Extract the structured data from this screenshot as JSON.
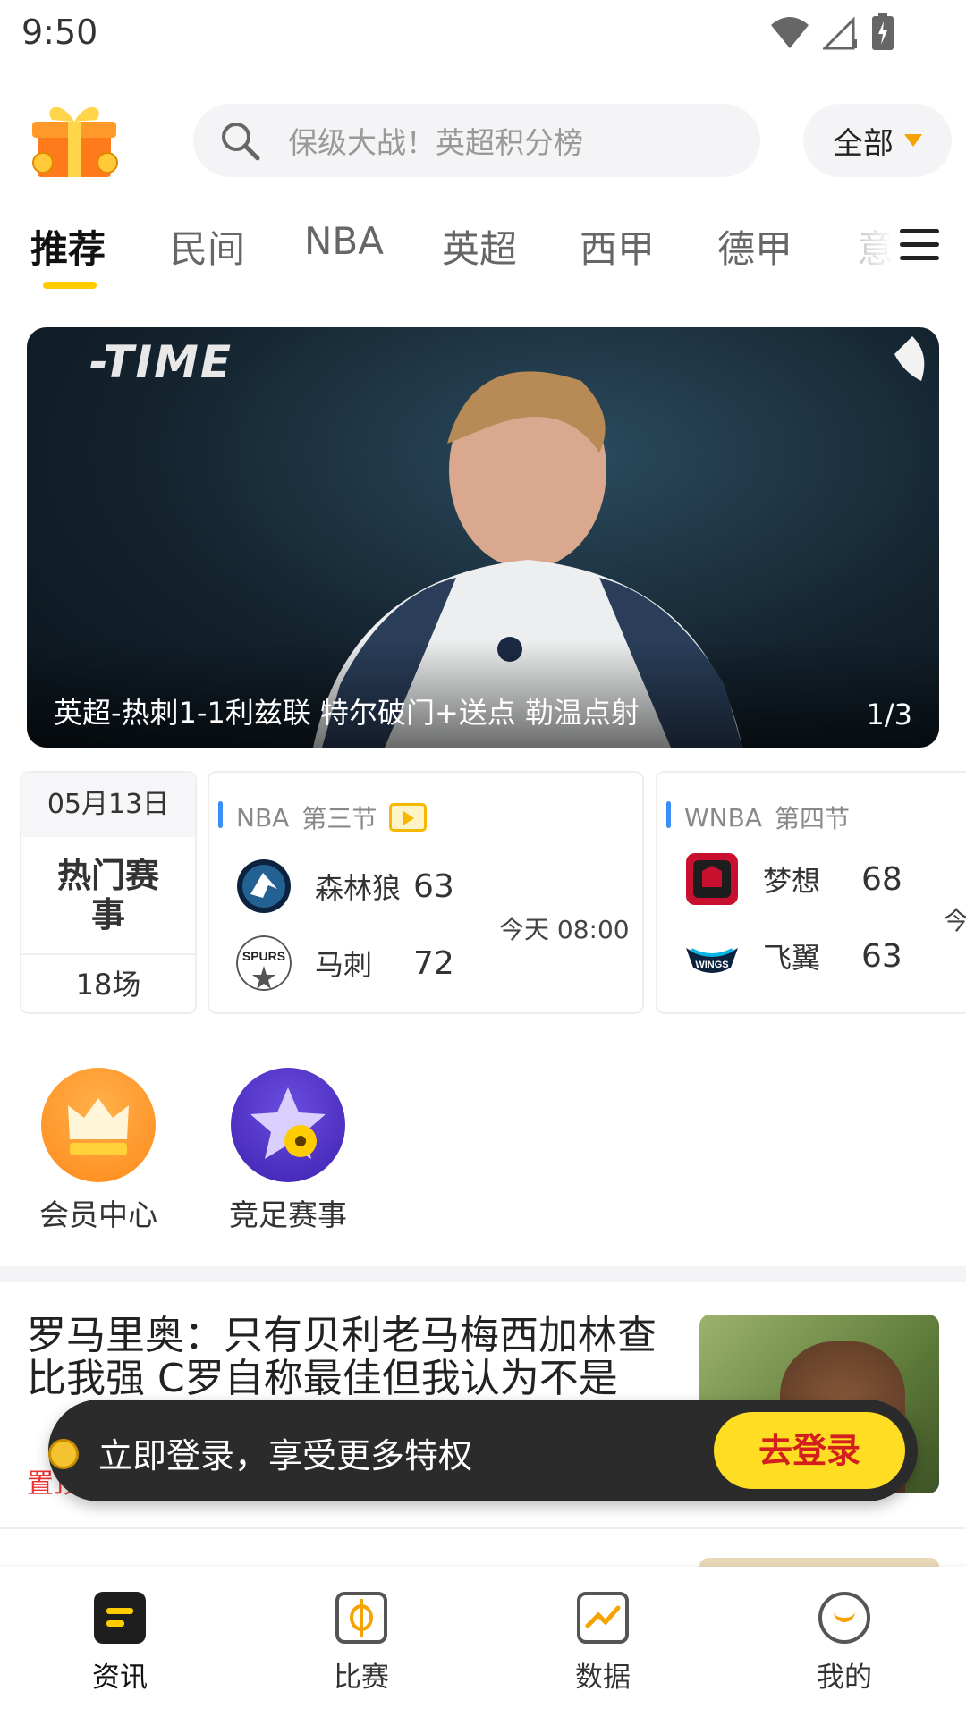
{
  "status_bar": {
    "time": "9:50"
  },
  "header": {
    "search_placeholder": "保级大战！英超积分榜",
    "filter_label": "全部"
  },
  "tabs": [
    "推荐",
    "民间",
    "NBA",
    "英超",
    "西甲",
    "德甲",
    "意"
  ],
  "banner": {
    "overlay_text": "-TIME",
    "caption": "英超-热刺1-1利兹联 特尔破门+送点 勒温点射",
    "pager": "1/3"
  },
  "hot_events": {
    "date": "05月13日",
    "title": "热门赛事",
    "count": "18场"
  },
  "matches": [
    {
      "league": "NBA",
      "period": "第三节",
      "time": "今天 08:00",
      "teams": [
        {
          "name": "森林狼",
          "score": "63"
        },
        {
          "name": "马刺",
          "score": "72"
        }
      ]
    },
    {
      "league": "WNBA",
      "period": "第四节",
      "time": "今",
      "teams": [
        {
          "name": "梦想",
          "score": "68"
        },
        {
          "name": "飞翼",
          "score": "63"
        }
      ]
    }
  ],
  "quick_entries": [
    {
      "label": "会员中心"
    },
    {
      "label": "竞足赛事"
    }
  ],
  "news": [
    {
      "headline": "罗马里奥：只有贝利老马梅西加林查比我强 C罗自称最佳但我认为不是",
      "tag": "置顶"
    }
  ],
  "login_toast": {
    "message": "立即登录，享受更多特权",
    "button": "去登录"
  },
  "bottom_nav": [
    {
      "label": "资讯"
    },
    {
      "label": "比赛"
    },
    {
      "label": "数据"
    },
    {
      "label": "我的"
    }
  ],
  "colors": {
    "accent": "#ffcc00",
    "link_red": "#d41f1f",
    "league_bar": "#3a8ef6"
  }
}
